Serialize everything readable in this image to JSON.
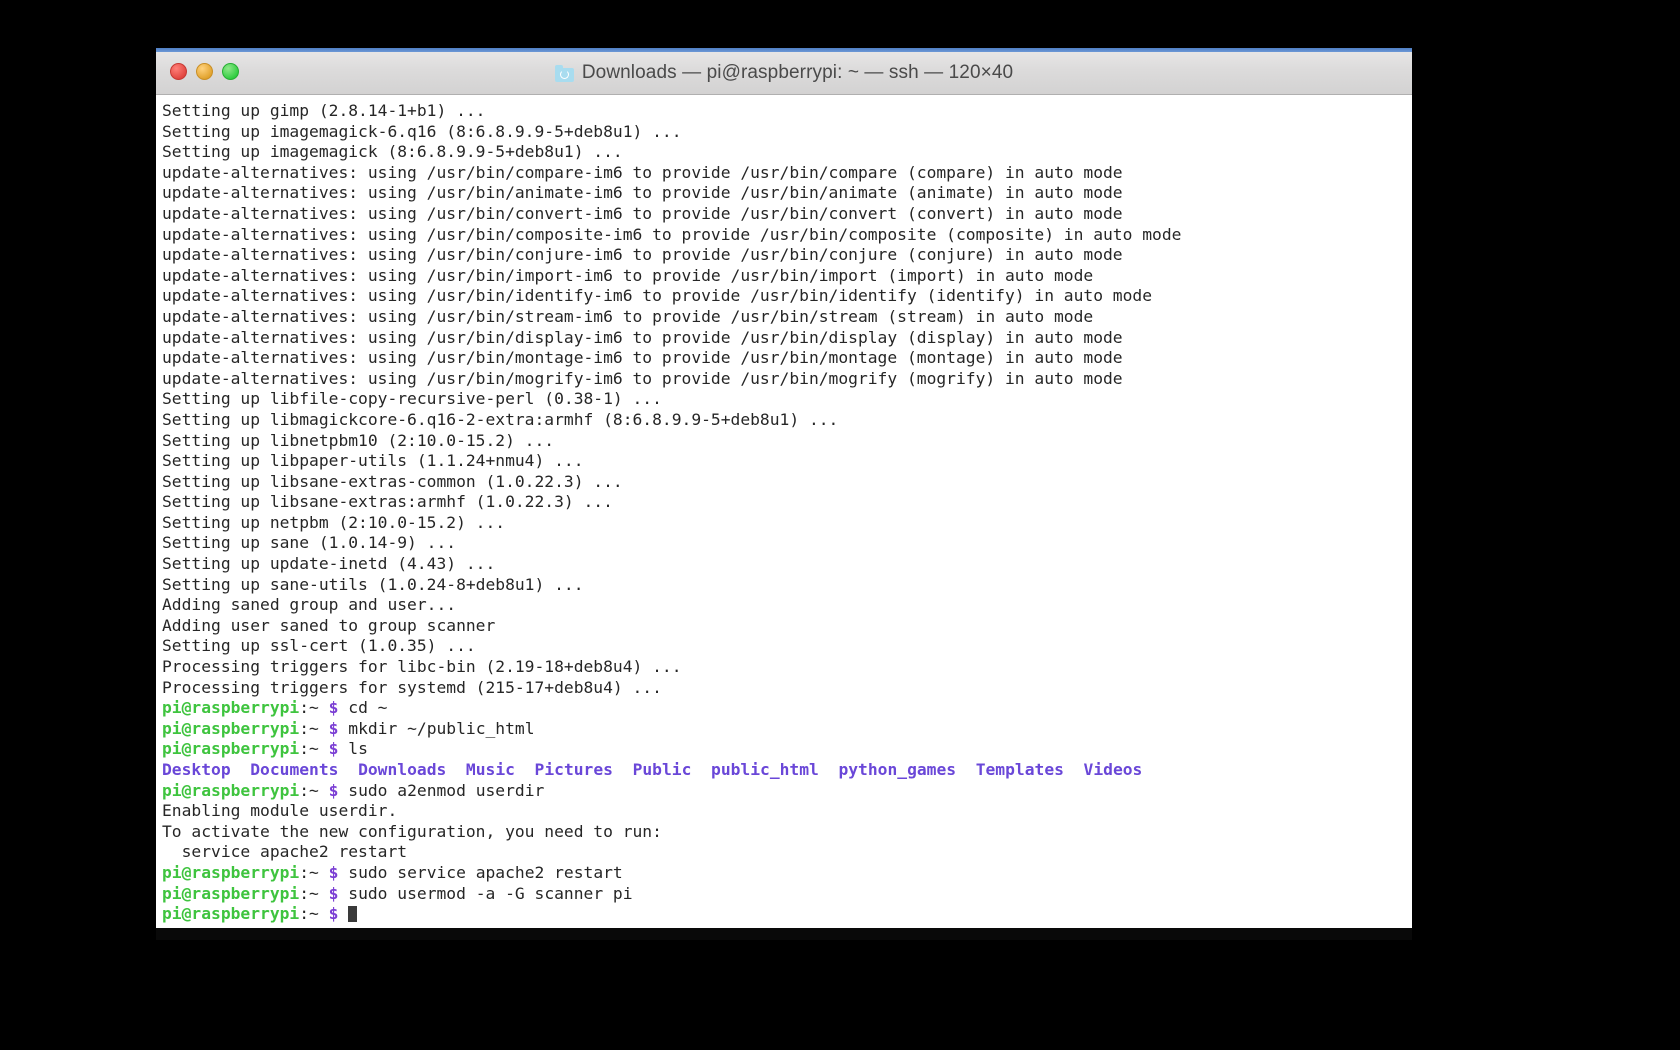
{
  "window": {
    "title": "Downloads — pi@raspberrypi: ~ — ssh — 120×40",
    "folder_icon": "folder-icon",
    "traffic_lights": {
      "close": "close-button",
      "minimize": "minimize-button",
      "maximize": "maximize-button"
    },
    "colors": {
      "titlebar_accent": "#4f7fc4",
      "terminal_bg": "#ffffff",
      "text": "#262626",
      "prompt_user": "#3fc43f",
      "prompt_dollar": "#7b3fd4",
      "directory": "#6a47d8",
      "desktop_bg": "#000000"
    }
  },
  "terminal": {
    "prompt_user_host": "pi@raspberrypi",
    "prompt_path": ":~ ",
    "prompt_symbol": "$",
    "lines": [
      {
        "type": "plain",
        "text": "Setting up gimp (2.8.14-1+b1) ..."
      },
      {
        "type": "plain",
        "text": "Setting up imagemagick-6.q16 (8:6.8.9.9-5+deb8u1) ..."
      },
      {
        "type": "plain",
        "text": "Setting up imagemagick (8:6.8.9.9-5+deb8u1) ..."
      },
      {
        "type": "plain",
        "text": "update-alternatives: using /usr/bin/compare-im6 to provide /usr/bin/compare (compare) in auto mode"
      },
      {
        "type": "plain",
        "text": "update-alternatives: using /usr/bin/animate-im6 to provide /usr/bin/animate (animate) in auto mode"
      },
      {
        "type": "plain",
        "text": "update-alternatives: using /usr/bin/convert-im6 to provide /usr/bin/convert (convert) in auto mode"
      },
      {
        "type": "plain",
        "text": "update-alternatives: using /usr/bin/composite-im6 to provide /usr/bin/composite (composite) in auto mode"
      },
      {
        "type": "plain",
        "text": "update-alternatives: using /usr/bin/conjure-im6 to provide /usr/bin/conjure (conjure) in auto mode"
      },
      {
        "type": "plain",
        "text": "update-alternatives: using /usr/bin/import-im6 to provide /usr/bin/import (import) in auto mode"
      },
      {
        "type": "plain",
        "text": "update-alternatives: using /usr/bin/identify-im6 to provide /usr/bin/identify (identify) in auto mode"
      },
      {
        "type": "plain",
        "text": "update-alternatives: using /usr/bin/stream-im6 to provide /usr/bin/stream (stream) in auto mode"
      },
      {
        "type": "plain",
        "text": "update-alternatives: using /usr/bin/display-im6 to provide /usr/bin/display (display) in auto mode"
      },
      {
        "type": "plain",
        "text": "update-alternatives: using /usr/bin/montage-im6 to provide /usr/bin/montage (montage) in auto mode"
      },
      {
        "type": "plain",
        "text": "update-alternatives: using /usr/bin/mogrify-im6 to provide /usr/bin/mogrify (mogrify) in auto mode"
      },
      {
        "type": "plain",
        "text": "Setting up libfile-copy-recursive-perl (0.38-1) ..."
      },
      {
        "type": "plain",
        "text": "Setting up libmagickcore-6.q16-2-extra:armhf (8:6.8.9.9-5+deb8u1) ..."
      },
      {
        "type": "plain",
        "text": "Setting up libnetpbm10 (2:10.0-15.2) ..."
      },
      {
        "type": "plain",
        "text": "Setting up libpaper-utils (1.1.24+nmu4) ..."
      },
      {
        "type": "plain",
        "text": "Setting up libsane-extras-common (1.0.22.3) ..."
      },
      {
        "type": "plain",
        "text": "Setting up libsane-extras:armhf (1.0.22.3) ..."
      },
      {
        "type": "plain",
        "text": "Setting up netpbm (2:10.0-15.2) ..."
      },
      {
        "type": "plain",
        "text": "Setting up sane (1.0.14-9) ..."
      },
      {
        "type": "plain",
        "text": "Setting up update-inetd (4.43) ..."
      },
      {
        "type": "plain",
        "text": "Setting up sane-utils (1.0.24-8+deb8u1) ..."
      },
      {
        "type": "plain",
        "text": "Adding saned group and user..."
      },
      {
        "type": "plain",
        "text": "Adding user saned to group scanner"
      },
      {
        "type": "plain",
        "text": "Setting up ssl-cert (1.0.35) ..."
      },
      {
        "type": "plain",
        "text": "Processing triggers for libc-bin (2.19-18+deb8u4) ..."
      },
      {
        "type": "plain",
        "text": "Processing triggers for systemd (215-17+deb8u4) ..."
      },
      {
        "type": "prompt",
        "command": "cd ~"
      },
      {
        "type": "prompt",
        "command": "mkdir ~/public_html"
      },
      {
        "type": "prompt",
        "command": "ls"
      },
      {
        "type": "dirlist",
        "items": [
          "Desktop",
          "Documents",
          "Downloads",
          "Music",
          "Pictures",
          "Public",
          "public_html",
          "python_games",
          "Templates",
          "Videos"
        ]
      },
      {
        "type": "prompt",
        "command": "sudo a2enmod userdir"
      },
      {
        "type": "plain",
        "text": "Enabling module userdir."
      },
      {
        "type": "plain",
        "text": "To activate the new configuration, you need to run:"
      },
      {
        "type": "plain",
        "text": "  service apache2 restart"
      },
      {
        "type": "prompt",
        "command": "sudo service apache2 restart"
      },
      {
        "type": "prompt",
        "command": "sudo usermod -a -G scanner pi"
      },
      {
        "type": "prompt",
        "command": "",
        "cursor": true
      }
    ]
  }
}
